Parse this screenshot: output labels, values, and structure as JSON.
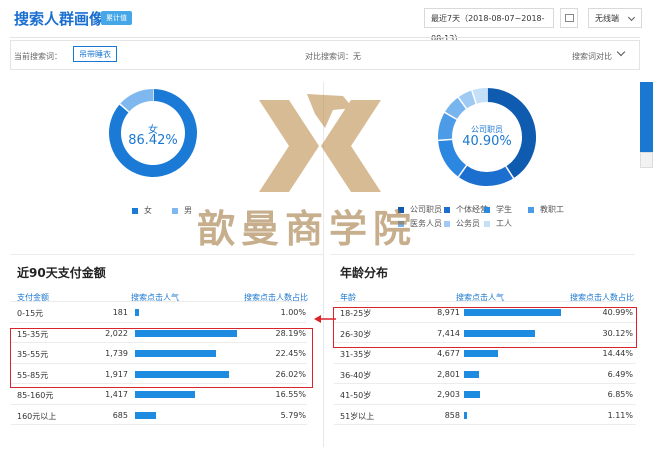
{
  "header": {
    "title": "搜索人群画像",
    "badge": "累计值",
    "date_range": "最近7天（2018-08-07~2018-08-13）",
    "device": "无线端"
  },
  "search_bar": {
    "current_label": "当前搜索词：",
    "current_value": "吊带睡衣",
    "compare_label": "对比搜索词：无",
    "compare_toggle": "搜索词对比"
  },
  "gender": {
    "center_label": "女",
    "center_value": "86.42%",
    "legend": [
      "女",
      "男"
    ],
    "values": [
      86.42,
      13.58
    ],
    "colors": [
      "#1a7ad6",
      "#7fb8ee"
    ]
  },
  "occupation": {
    "center_label": "公司职员",
    "center_value": "40.90%",
    "legend": [
      "公司职员",
      "个体经营",
      "学生",
      "教职工",
      "医务人员",
      "公务员",
      "工人"
    ],
    "values": [
      40.9,
      19.0,
      14.0,
      9.5,
      6.6,
      5.0,
      5.0
    ],
    "colors": [
      "#0e5bb0",
      "#1d6fcf",
      "#2b87e0",
      "#4b9be6",
      "#78b4ee",
      "#9fcaf3",
      "#c4dff8"
    ]
  },
  "watermark": {
    "text": "歆曼商学院"
  },
  "payment": {
    "title": "近90天支付金额",
    "columns": [
      "支付金额",
      "搜索点击人气",
      "搜索点击人数占比"
    ],
    "rows": [
      {
        "label": "0-15元",
        "popularity": "181",
        "pct": "1.00%",
        "bar": 1.0
      },
      {
        "label": "15-35元",
        "popularity": "2,022",
        "pct": "28.19%",
        "bar": 28.19
      },
      {
        "label": "35-55元",
        "popularity": "1,739",
        "pct": "22.45%",
        "bar": 22.45
      },
      {
        "label": "55-85元",
        "popularity": "1,917",
        "pct": "26.02%",
        "bar": 26.02
      },
      {
        "label": "85-160元",
        "popularity": "1,417",
        "pct": "16.55%",
        "bar": 16.55
      },
      {
        "label": "160元以上",
        "popularity": "685",
        "pct": "5.79%",
        "bar": 5.79
      }
    ]
  },
  "age": {
    "title": "年龄分布",
    "columns": [
      "年龄",
      "搜索点击人气",
      "搜索点击人数占比"
    ],
    "rows": [
      {
        "label": "18-25岁",
        "popularity": "8,971",
        "pct": "40.99%",
        "bar": 40.99
      },
      {
        "label": "26-30岁",
        "popularity": "7,414",
        "pct": "30.12%",
        "bar": 30.12
      },
      {
        "label": "31-35岁",
        "popularity": "4,677",
        "pct": "14.44%",
        "bar": 14.44
      },
      {
        "label": "36-40岁",
        "popularity": "2,801",
        "pct": "6.49%",
        "bar": 6.49
      },
      {
        "label": "41-50岁",
        "popularity": "2,903",
        "pct": "6.85%",
        "bar": 6.85
      },
      {
        "label": "51岁以上",
        "popularity": "858",
        "pct": "1.11%",
        "bar": 1.11
      }
    ]
  }
}
